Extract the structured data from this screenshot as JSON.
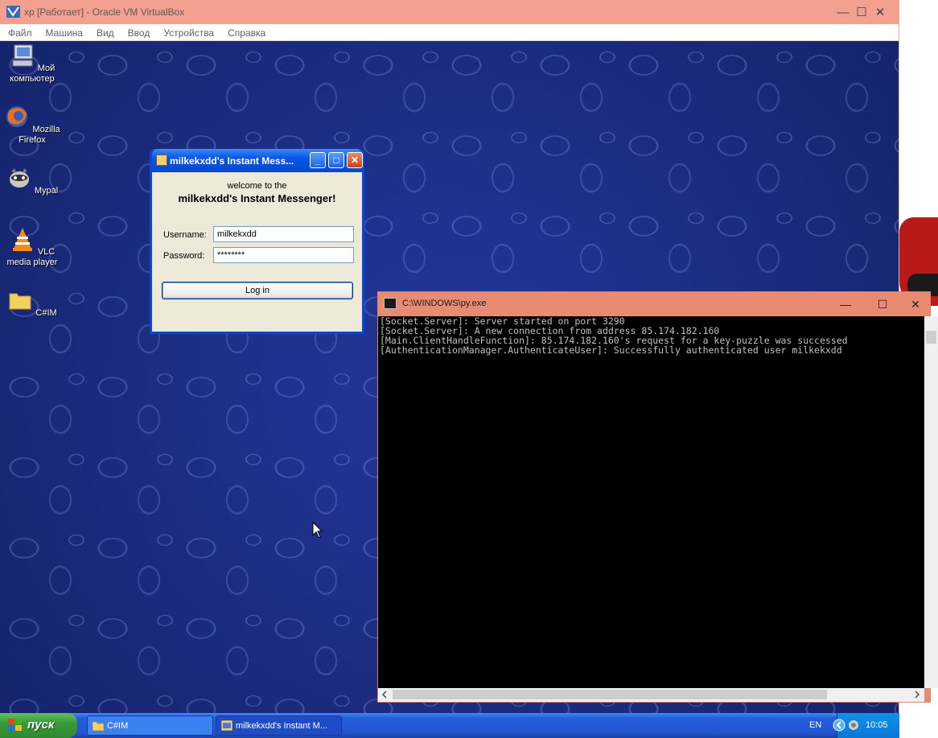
{
  "host": {
    "title": "xp [Работает] - Oracle VM VirtualBox",
    "menu": [
      "Файл",
      "Машина",
      "Вид",
      "Ввод",
      "Устройства",
      "Справка"
    ],
    "controls": {
      "minimize": "—",
      "maximize": "☐",
      "close": "✕"
    }
  },
  "desktop": {
    "icons": [
      {
        "label": "Мой компьютер",
        "icon": "computer-icon"
      },
      {
        "label": "Mozilla Firefox",
        "icon": "firefox-icon"
      },
      {
        "label": "Mypal",
        "icon": "mypal-icon"
      },
      {
        "label": "VLC media player",
        "icon": "vlc-icon"
      },
      {
        "label": "C#IM",
        "icon": "folder-icon"
      }
    ]
  },
  "login_window": {
    "title": "milkekxdd's Instant Mess...",
    "welcome_small": "welcome to the",
    "welcome_big": "milkekxdd's Instant Messenger!",
    "username_label": "Username:",
    "username_value": "milkekxdd",
    "password_label": "Password:",
    "password_value": "********",
    "login_button": "Log in",
    "controls": {
      "minimize": "_",
      "maximize": "□",
      "close": "✕"
    }
  },
  "console": {
    "title": "C:\\WINDOWS\\py.exe",
    "lines": [
      "[Socket.Server]: Server started on port 3290",
      "[Socket.Server]: A new connection from address 85.174.182.160",
      "[Main.ClientHandleFunction]: 85.174.182.160's request for a key-puzzle was successed",
      "[AuthenticationManager.AuthenticateUser]: Successfully authenticated user milkekxdd"
    ],
    "controls": {
      "minimize": "—",
      "maximize": "☐",
      "close": "✕"
    }
  },
  "taskbar": {
    "start_label": "пуск",
    "tasks": [
      {
        "label": "C#IM",
        "icon": "folder-icon"
      },
      {
        "label": "milkekxdd's Instant M...",
        "icon": "app-icon"
      }
    ],
    "lang": "EN",
    "clock": "10:05"
  },
  "colors": {
    "desktop_bg": "#1b2c7e",
    "xp_blue": "#0a46d8",
    "console_title": "#e98a72",
    "host_title": "#f4a090"
  }
}
